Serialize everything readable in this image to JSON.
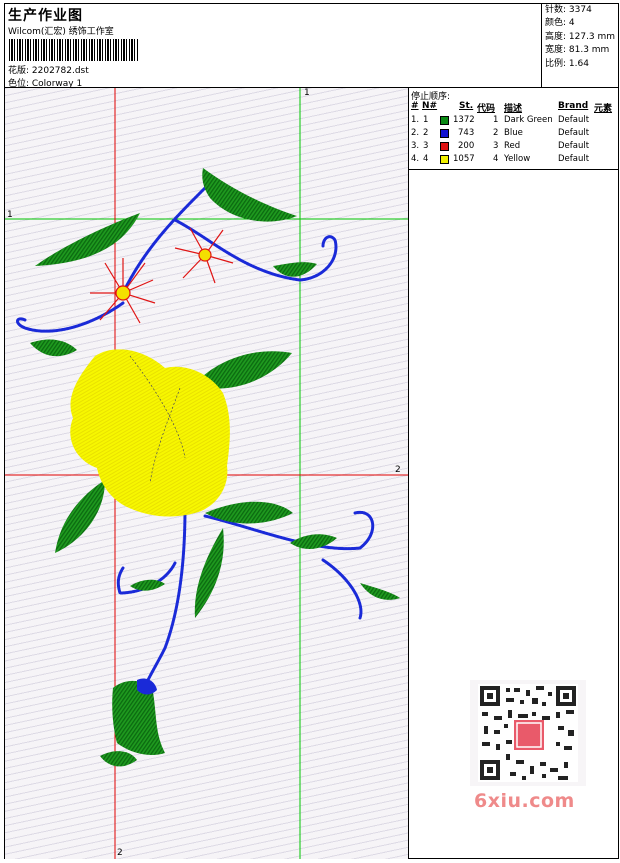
{
  "header": {
    "title": "生产作业图",
    "company": "Wilcom(汇宏) 绣饰工作室",
    "pattern_label": "花版: 2202782.dst",
    "colorway_label": "色位: Colorway 1"
  },
  "stats": [
    "针数: 3374",
    "颜色: 4",
    "高度: 127.3 mm",
    "宽度: 81.3 mm",
    "比例: 1.64"
  ],
  "stop_sequence": {
    "title": "停止顺序:",
    "columns": [
      "#",
      "N#",
      "St.",
      "代码",
      "描述",
      "Brand",
      "元素"
    ],
    "rows": [
      {
        "num": "1.",
        "n": "1",
        "color": "#0a8a14",
        "st": "1372",
        "code": "1",
        "desc": "Dark Green",
        "brand": "Default"
      },
      {
        "num": "2.",
        "n": "2",
        "color": "#1414d2",
        "st": "743",
        "code": "2",
        "desc": "Blue",
        "brand": "Default"
      },
      {
        "num": "3.",
        "n": "3",
        "color": "#e01414",
        "st": "200",
        "code": "3",
        "desc": "Red",
        "brand": "Default"
      },
      {
        "num": "4.",
        "n": "4",
        "color": "#f0f000",
        "st": "1057",
        "code": "4",
        "desc": "Yellow",
        "brand": "Default"
      }
    ]
  },
  "axis_labels": {
    "green_top": "1",
    "green_left": "1",
    "red_right": "2",
    "red_bottom": "2"
  },
  "watermark": {
    "text": "6xiu.com"
  }
}
